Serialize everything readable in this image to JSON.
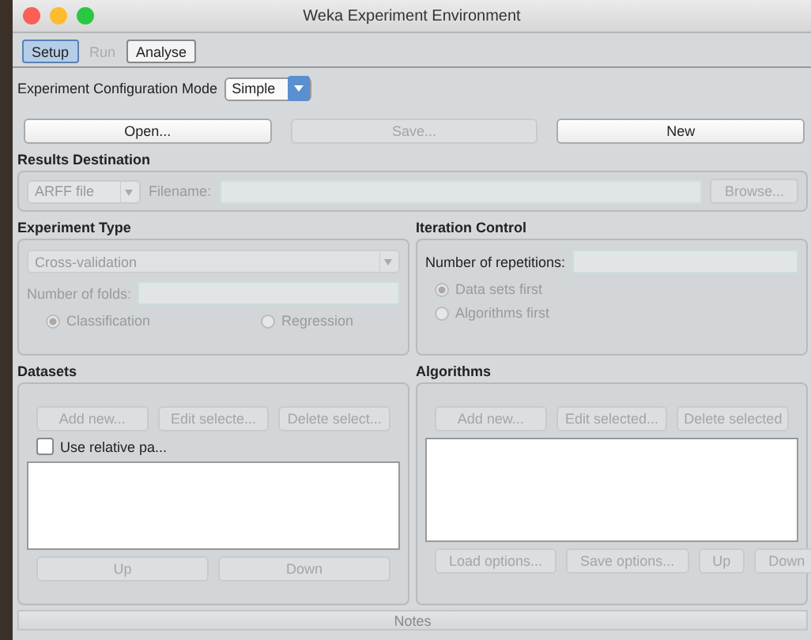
{
  "window": {
    "title": "Weka Experiment Environment"
  },
  "tabs": [
    {
      "label": "Setup",
      "selected": true,
      "disabled": false
    },
    {
      "label": "Run",
      "selected": false,
      "disabled": true
    },
    {
      "label": "Analyse",
      "selected": false,
      "disabled": false
    }
  ],
  "config_mode": {
    "label": "Experiment Configuration Mode",
    "value": "Simple"
  },
  "top_buttons": [
    {
      "label": "Open...",
      "disabled": false
    },
    {
      "label": "Save...",
      "disabled": true
    },
    {
      "label": "New",
      "disabled": false
    }
  ],
  "results_destination": {
    "title": "Results Destination",
    "type": "ARFF file",
    "filename_label": "Filename:",
    "browse": {
      "label": "Browse...",
      "disabled": true
    }
  },
  "experiment_type": {
    "title": "Experiment Type",
    "method": "Cross-validation",
    "folds_label": "Number of folds:",
    "radios": [
      {
        "label": "Classification",
        "selected": true
      },
      {
        "label": "Regression",
        "selected": false
      }
    ]
  },
  "iteration_control": {
    "title": "Iteration Control",
    "repetitions_label": "Number of repetitions:",
    "radios": [
      {
        "label": "Data sets first",
        "selected": true
      },
      {
        "label": "Algorithms first",
        "selected": false
      }
    ]
  },
  "datasets": {
    "title": "Datasets",
    "buttons": [
      {
        "label": "Add new...",
        "disabled": true
      },
      {
        "label": "Edit selecte...",
        "disabled": true
      },
      {
        "label": "Delete select...",
        "disabled": true
      }
    ],
    "checkbox": {
      "label": "Use relative pa...",
      "checked": false
    },
    "bottom_buttons": [
      {
        "label": "Up",
        "disabled": true
      },
      {
        "label": "Down",
        "disabled": true
      }
    ]
  },
  "algorithms": {
    "title": "Algorithms",
    "buttons": [
      {
        "label": "Add new...",
        "disabled": true
      },
      {
        "label": "Edit selected...",
        "disabled": true
      },
      {
        "label": "Delete selected",
        "disabled": true
      }
    ],
    "bottom_buttons": [
      {
        "label": "Load options...",
        "disabled": true
      },
      {
        "label": "Save options...",
        "disabled": true
      },
      {
        "label": "Up",
        "disabled": true
      },
      {
        "label": "Down",
        "disabled": true
      }
    ]
  },
  "notes": {
    "label": "Notes"
  }
}
